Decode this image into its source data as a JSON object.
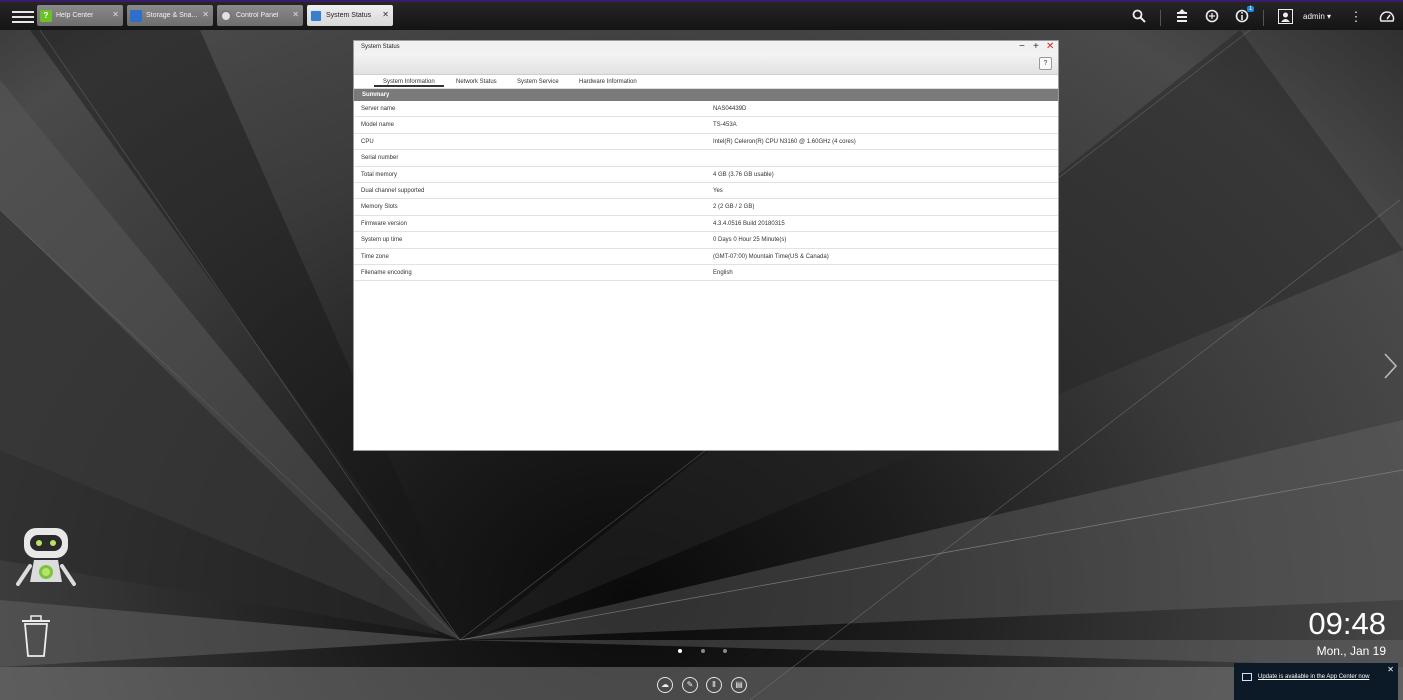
{
  "taskbar": {
    "tabs": [
      {
        "label": "Help Center",
        "icon": "help-center-icon"
      },
      {
        "label": "Storage & Sna...",
        "icon": "storage-icon"
      },
      {
        "label": "Control Panel",
        "icon": "control-panel-icon"
      },
      {
        "label": "System Status",
        "icon": "system-status-icon"
      }
    ],
    "user": "admin ▾",
    "notification_count": "1",
    "icons": [
      "search-icon",
      "background-tasks-icon",
      "sync-icon",
      "info-icon",
      "user-icon",
      "more-icon",
      "dashboard-icon"
    ]
  },
  "window": {
    "title": "System Status",
    "help": "?",
    "tabs": [
      "System Information",
      "Network Status",
      "System Service",
      "Hardware Information"
    ],
    "active_tab": "System Information",
    "section": "Summary",
    "rows": [
      {
        "key": "Server name",
        "value": "NAS04439D"
      },
      {
        "key": "Model name",
        "value": "TS-453A"
      },
      {
        "key": "CPU",
        "value": "Intel(R) Celeron(R) CPU N3160 @ 1.60GHz (4 cores)"
      },
      {
        "key": "Serial number",
        "value": ""
      },
      {
        "key": "Total memory",
        "value": "4 GB (3.76 GB usable)"
      },
      {
        "key": "Dual channel supported",
        "value": "Yes"
      },
      {
        "key": "Memory Slots",
        "value": "2 (2 GB / 2 GB)"
      },
      {
        "key": "Firmware version",
        "value": "4.3.4.0516 Build 20180315"
      },
      {
        "key": "System up time",
        "value": "0 Days 0 Hour 25 Minute(s)"
      },
      {
        "key": "Time zone",
        "value": "(GMT-07:00) Mountain Time(US & Canada)"
      },
      {
        "key": "Filename encoding",
        "value": "English"
      }
    ]
  },
  "clock": {
    "time": "09:48",
    "date": "Mon., Jan 19"
  },
  "notification": {
    "text": "Update is available in the App Center now",
    "close": "✕"
  },
  "colors": {
    "accent": "#1e88e5",
    "section_bg": "#7a7a7a",
    "topbar_border": "#3a1a6a"
  }
}
